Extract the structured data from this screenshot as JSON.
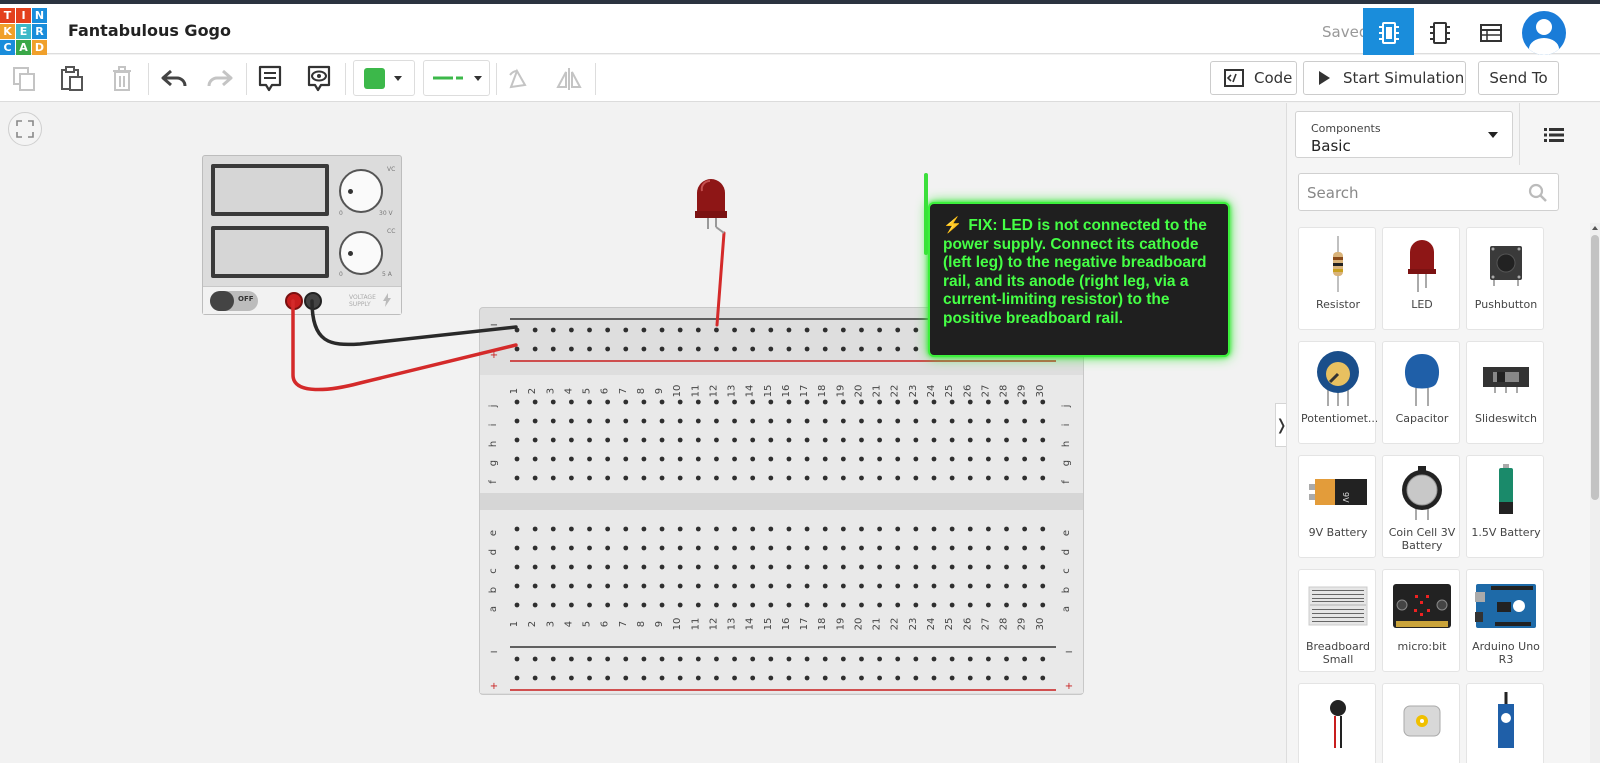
{
  "app": {
    "logo_letters": [
      "T",
      "I",
      "N",
      "K",
      "E",
      "R",
      "C",
      "A",
      "D"
    ],
    "logo_colors": [
      "#e3401d",
      "#e3401d",
      "#1a8ddb",
      "#f0a02b",
      "#3cb8c8",
      "#1a8ddb",
      "#1a8ddb",
      "#3aa848",
      "#f0a02b"
    ],
    "project_title": "Fantabulous Gogo",
    "save_status": "Saved"
  },
  "header": {
    "views": [
      "circuit-view-icon",
      "schematic-view-icon",
      "component-list-icon"
    ]
  },
  "toolbar": {
    "fill_color": "#3cb84a",
    "wire_color": "#3cb84a",
    "code_label": "Code",
    "simulate_label": "Start Simulation",
    "send_label": "Send To"
  },
  "canvas": {
    "psu_labels": {
      "vc": "VC",
      "cc": "CC",
      "v_max": "30 V",
      "a_max": "5 A",
      "zero": "0",
      "switch": "OFF",
      "brand": "VOLTAGE SUPPLY"
    },
    "breadboard": {
      "columns": [
        "1",
        "2",
        "3",
        "4",
        "5",
        "6",
        "7",
        "8",
        "9",
        "10",
        "11",
        "12",
        "13",
        "14",
        "15",
        "16",
        "17",
        "18",
        "19",
        "20",
        "21",
        "22",
        "23",
        "24",
        "25",
        "26",
        "27",
        "28",
        "29",
        "30"
      ],
      "upper_rows": [
        "j",
        "i",
        "h",
        "g",
        "f"
      ],
      "lower_rows": [
        "e",
        "d",
        "c",
        "b",
        "a"
      ],
      "minus": "−",
      "plus": "+"
    },
    "tooltip": {
      "bolt": "⚡",
      "text": "FIX: LED is not connected to the power supply. Connect its cathode (left leg) to the negative breadboard rail, and its anode (right leg, via a current-limiting resistor) to the positive breadboard rail."
    }
  },
  "panel": {
    "components_label": "Components",
    "components_value": "Basic",
    "search_placeholder": "Search",
    "items": [
      {
        "name": "Resistor",
        "icon": "resistor-icon"
      },
      {
        "name": "LED",
        "icon": "led-icon"
      },
      {
        "name": "Pushbutton",
        "icon": "pushbutton-icon"
      },
      {
        "name": "Potentiomet...",
        "icon": "potentiometer-icon"
      },
      {
        "name": "Capacitor",
        "icon": "capacitor-icon"
      },
      {
        "name": "Slideswitch",
        "icon": "slideswitch-icon"
      },
      {
        "name": "9V Battery",
        "icon": "battery-9v-icon"
      },
      {
        "name": "Coin Cell 3V Battery",
        "icon": "coin-cell-icon"
      },
      {
        "name": "1.5V Battery",
        "icon": "battery-aa-icon"
      },
      {
        "name": "Breadboard Small",
        "icon": "breadboard-icon"
      },
      {
        "name": "micro:bit",
        "icon": "microbit-icon"
      },
      {
        "name": "Arduino Uno R3",
        "icon": "arduino-icon"
      },
      {
        "name": "",
        "icon": "vibration-motor-icon"
      },
      {
        "name": "",
        "icon": "dc-motor-icon"
      },
      {
        "name": "",
        "icon": "servo-icon"
      }
    ]
  }
}
